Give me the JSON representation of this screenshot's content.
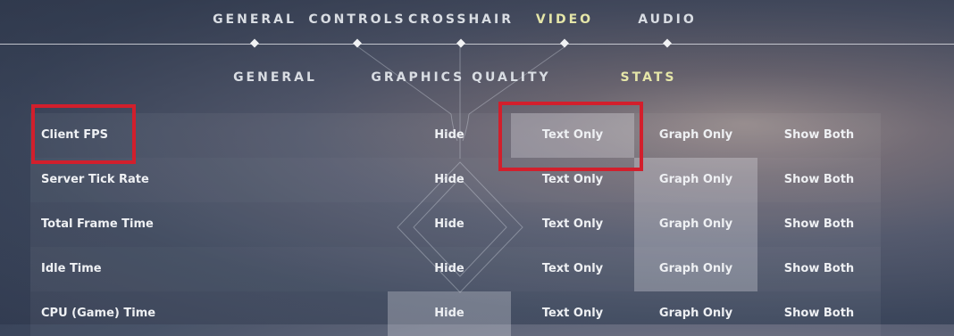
{
  "top_tabs": [
    {
      "label": "GENERAL",
      "active": false
    },
    {
      "label": "CONTROLS",
      "active": false
    },
    {
      "label": "CROSSHAIR",
      "active": false
    },
    {
      "label": "VIDEO",
      "active": true
    },
    {
      "label": "AUDIO",
      "active": false
    }
  ],
  "sub_tabs": [
    {
      "label": "GENERAL",
      "active": false
    },
    {
      "label": "GRAPHICS QUALITY",
      "active": false
    },
    {
      "label": "STATS",
      "active": true
    }
  ],
  "options": [
    "Hide",
    "Text Only",
    "Graph Only",
    "Show Both"
  ],
  "rows": [
    {
      "label": "Client FPS",
      "selected": "Text Only"
    },
    {
      "label": "Server Tick Rate",
      "selected": "Graph Only"
    },
    {
      "label": "Total Frame Time",
      "selected": "Graph Only"
    },
    {
      "label": "Idle Time",
      "selected": "Graph Only"
    },
    {
      "label": "CPU (Game) Time",
      "selected": "Hide"
    }
  ],
  "colors": {
    "active_tab": "#e5e6a8",
    "text": "#eef0f3",
    "highlight_box": "#d21f2c"
  }
}
